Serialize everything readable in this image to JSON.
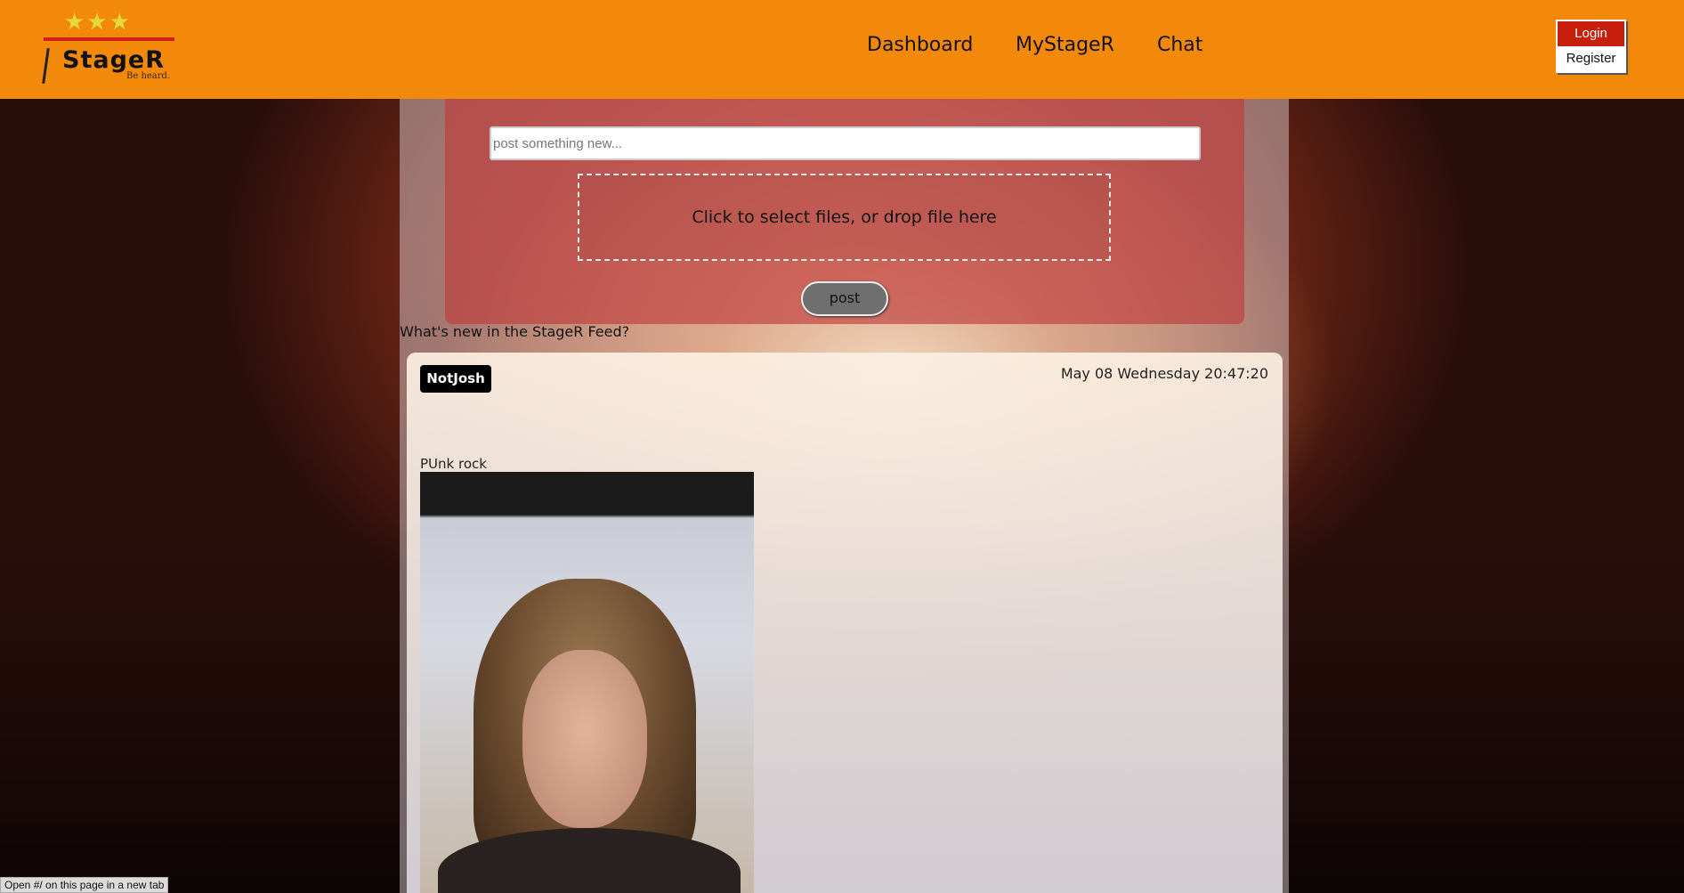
{
  "header": {
    "brand": "StageR",
    "tagline": "Be heard.",
    "nav": [
      "Dashboard",
      "MyStageR",
      "Chat"
    ],
    "login": "Login",
    "register": "Register"
  },
  "composer": {
    "placeholder": "post something new...",
    "dropzone": "Click to select files, or drop file here",
    "post_label": "post"
  },
  "feed": {
    "heading": "What's new in the StageR Feed?",
    "posts": [
      {
        "user": "NotJosh",
        "timestamp": "May 08 Wednesday 20:47:20",
        "text": "PUnk rock"
      }
    ]
  },
  "status_bar": "Open #/ on this page in a new tab",
  "colors": {
    "header": "#f2890b",
    "login": "#c81e0c"
  }
}
